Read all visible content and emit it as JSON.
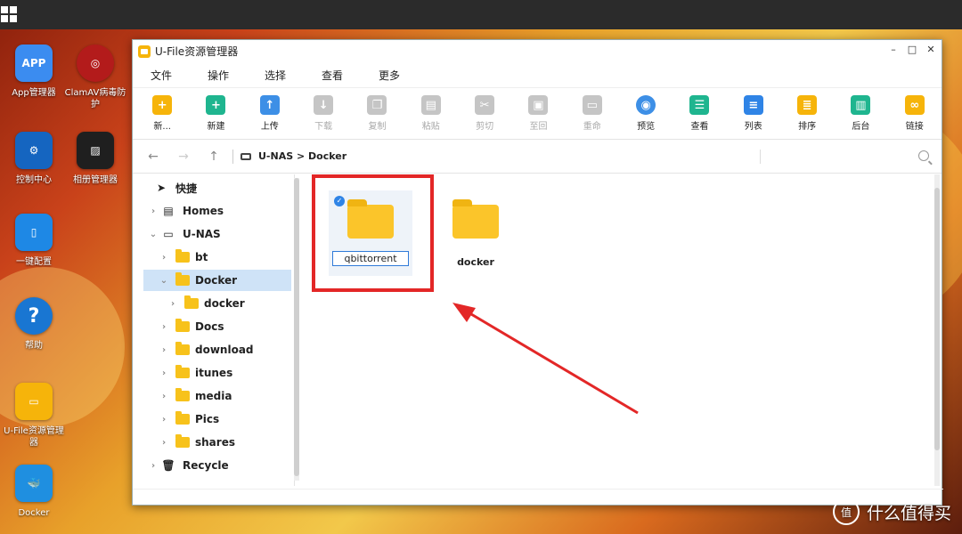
{
  "desktop": {
    "icons": [
      {
        "label": "App管理器",
        "tile_text": "APP",
        "color": "#3b8cf0"
      },
      {
        "label": "ClamAV病毒防护",
        "tile_text": "",
        "color": "#b31b1b"
      },
      {
        "label": "控制中心",
        "tile_text": "",
        "color": "#1565c0"
      },
      {
        "label": "相册管理器",
        "tile_text": "",
        "color": "#1f1f1f"
      },
      {
        "label": "一键配置",
        "tile_text": "",
        "color": "#1e88e5"
      },
      {
        "label": "帮助",
        "tile_text": "?",
        "color": "#1976d2"
      },
      {
        "label": "U-File资源管理器",
        "tile_text": "",
        "color": "#f6b40a"
      },
      {
        "label": "Docker",
        "tile_text": "",
        "color": "#1f8fe0"
      }
    ]
  },
  "window": {
    "title": "U-File资源管理器",
    "controls": {
      "minimize": "–",
      "maximize": "□",
      "close": "✕"
    }
  },
  "menu": [
    "文件",
    "操作",
    "选择",
    "查看",
    "更多"
  ],
  "toolbar": [
    {
      "label": "新...",
      "icon": "+",
      "color": "#f6b40a",
      "enabled": true
    },
    {
      "label": "新建",
      "icon": "+",
      "color": "#1fb58f",
      "enabled": true
    },
    {
      "label": "上传",
      "icon": "↑",
      "color": "#3d8fe6",
      "enabled": true
    },
    {
      "label": "下载",
      "icon": "↓",
      "color": "#c5c5c5",
      "enabled": false
    },
    {
      "label": "复制",
      "icon": "❐",
      "color": "#c5c5c5",
      "enabled": false
    },
    {
      "label": "粘贴",
      "icon": "▤",
      "color": "#c5c5c5",
      "enabled": false
    },
    {
      "label": "剪切",
      "icon": "✂",
      "color": "#c5c5c5",
      "enabled": false
    },
    {
      "label": "至回",
      "icon": "▣",
      "color": "#c5c5c5",
      "enabled": false
    },
    {
      "label": "重命",
      "icon": "▭",
      "color": "#c5c5c5",
      "enabled": false
    },
    {
      "label": "预览",
      "icon": "◉",
      "color": "#3d8fe6",
      "enabled": true
    },
    {
      "label": "查看",
      "icon": "☰",
      "color": "#1fb58f",
      "enabled": true
    },
    {
      "label": "列表",
      "icon": "≡",
      "color": "#2f84e6",
      "enabled": true
    },
    {
      "label": "排序",
      "icon": "≣",
      "color": "#f6b40a",
      "enabled": true
    },
    {
      "label": "后台",
      "icon": "▥",
      "color": "#1fb58f",
      "enabled": true
    },
    {
      "label": "链接",
      "icon": "∞",
      "color": "#f6b40a",
      "enabled": true
    }
  ],
  "nav": {
    "back": "←",
    "forward": "→",
    "up": "↑",
    "path": [
      "U-NAS",
      "Docker"
    ],
    "path_sep": ">"
  },
  "sidebar": {
    "quick": "快捷",
    "homes": "Homes",
    "root": "U-NAS",
    "folders": [
      "bt",
      "Docker",
      "docker",
      "Docs",
      "download",
      "itunes",
      "media",
      "Pics",
      "shares"
    ],
    "recycle": "Recycle"
  },
  "files": [
    {
      "name": "qbittorrent",
      "selected": true,
      "editing": true
    },
    {
      "name": "docker",
      "selected": false,
      "editing": false
    }
  ],
  "watermark": {
    "logo": "值",
    "text": "什么值得买"
  }
}
